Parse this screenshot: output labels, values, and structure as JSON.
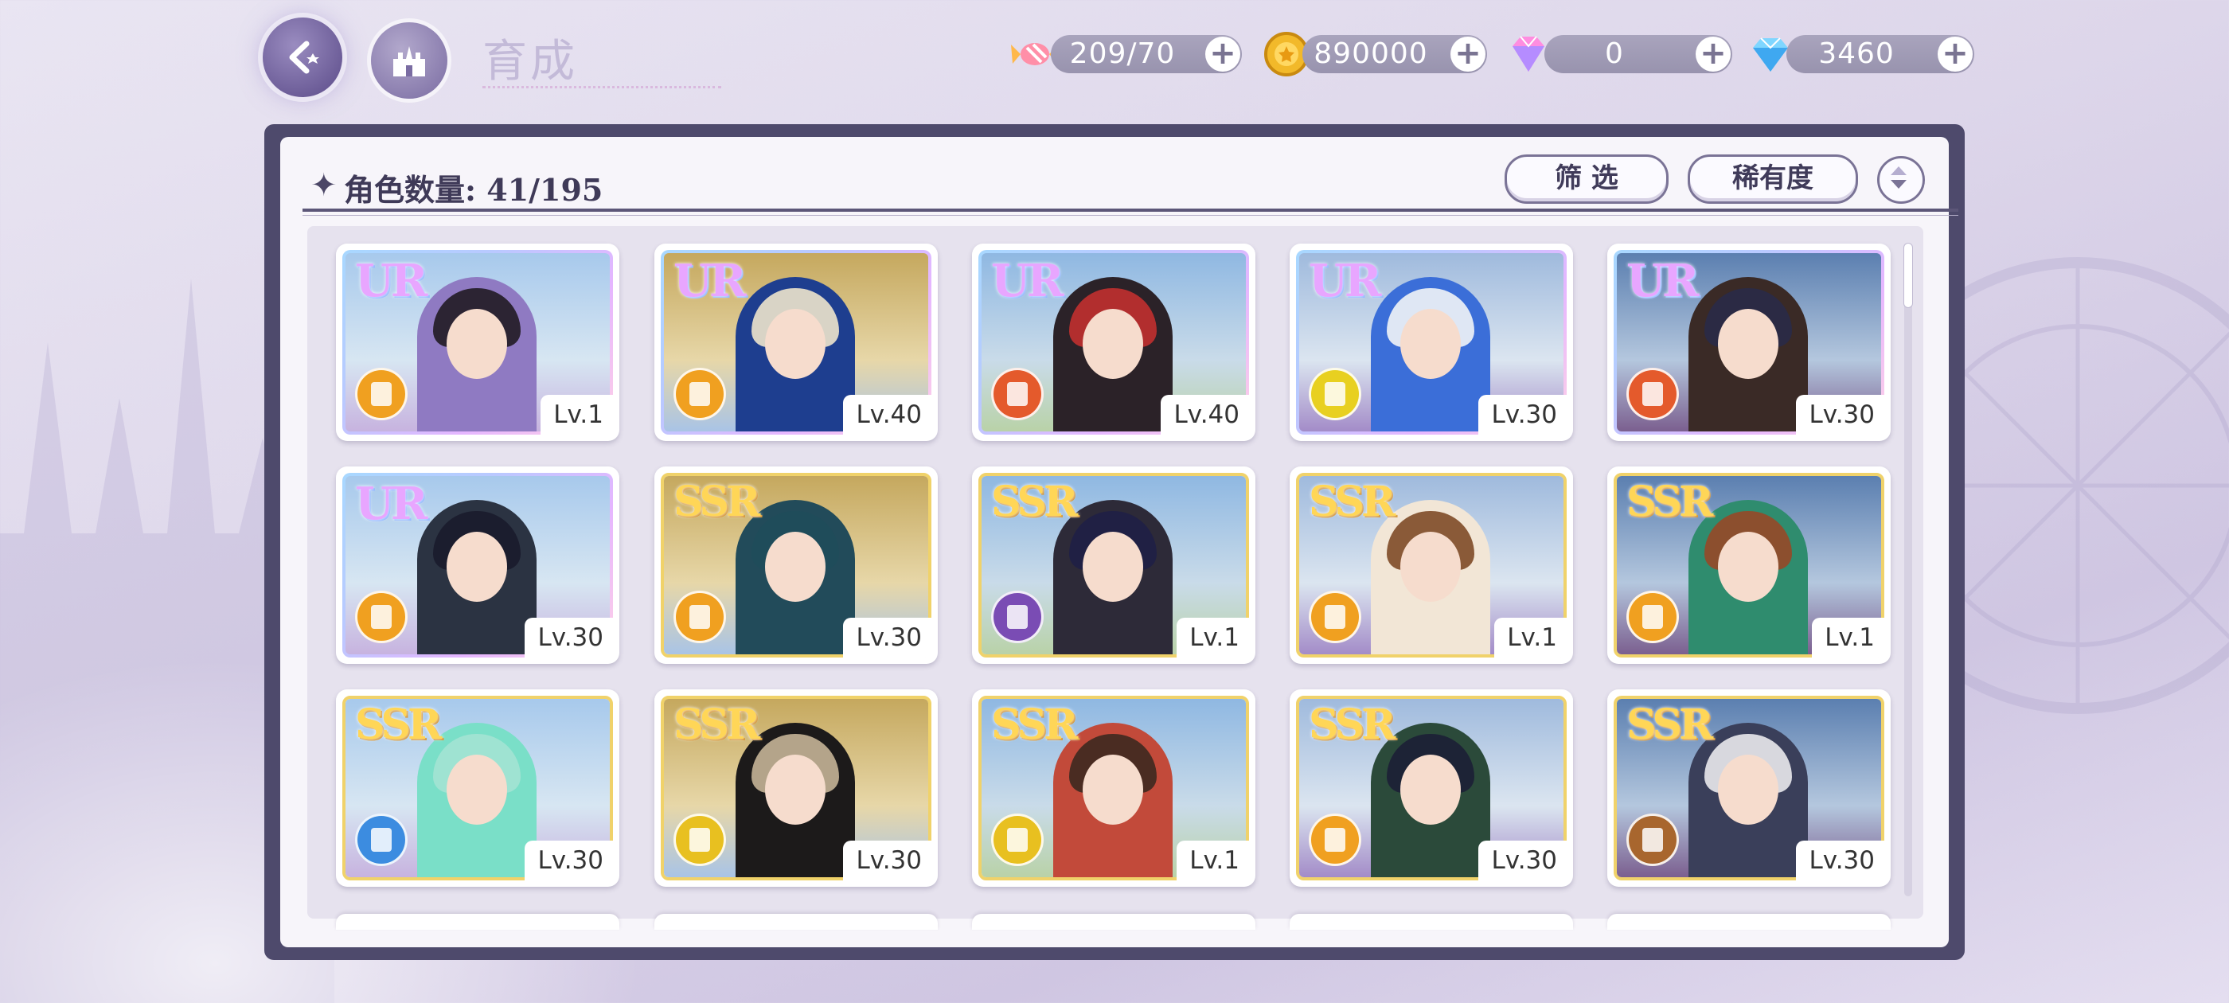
{
  "header": {
    "title": "育成"
  },
  "resources": [
    {
      "name": "stamina",
      "icon": "candy-icon",
      "value": "209/70"
    },
    {
      "name": "gold",
      "icon": "gold-coin-icon",
      "value": "890000"
    },
    {
      "name": "pink-gem",
      "icon": "pink-diamond-icon",
      "value": "0"
    },
    {
      "name": "blue-gem",
      "icon": "blue-diamond-icon",
      "value": "3460"
    }
  ],
  "panel": {
    "count_label": "角色数量: 41/195",
    "filter_label": "筛 选",
    "sort_label": "稀有度"
  },
  "cards": [
    {
      "rarity": "UR",
      "level": "Lv.1",
      "type_color": "#f0a020"
    },
    {
      "rarity": "UR",
      "level": "Lv.40",
      "type_color": "#f0a020"
    },
    {
      "rarity": "UR",
      "level": "Lv.40",
      "type_color": "#e45a2c"
    },
    {
      "rarity": "UR",
      "level": "Lv.30",
      "type_color": "#e8d020"
    },
    {
      "rarity": "UR",
      "level": "Lv.30",
      "type_color": "#e45a2c"
    },
    {
      "rarity": "UR",
      "level": "Lv.30",
      "type_color": "#f0a020"
    },
    {
      "rarity": "SSR",
      "level": "Lv.30",
      "type_color": "#f0a020"
    },
    {
      "rarity": "SSR",
      "level": "Lv.1",
      "type_color": "#7a4cb4"
    },
    {
      "rarity": "SSR",
      "level": "Lv.1",
      "type_color": "#f0a020"
    },
    {
      "rarity": "SSR",
      "level": "Lv.1",
      "type_color": "#f0a020"
    },
    {
      "rarity": "SSR",
      "level": "Lv.30",
      "type_color": "#3c8ce0"
    },
    {
      "rarity": "SSR",
      "level": "Lv.30",
      "type_color": "#e8c020"
    },
    {
      "rarity": "SSR",
      "level": "Lv.1",
      "type_color": "#e8c020"
    },
    {
      "rarity": "SSR",
      "level": "Lv.30",
      "type_color": "#f0a020"
    },
    {
      "rarity": "SSR",
      "level": "Lv.30",
      "type_color": "#a8662e"
    }
  ],
  "colors": {
    "panel_border": "#4e4a6c",
    "ur_frame": "#c9b8ff",
    "ssr_frame": "#f0d26a"
  }
}
